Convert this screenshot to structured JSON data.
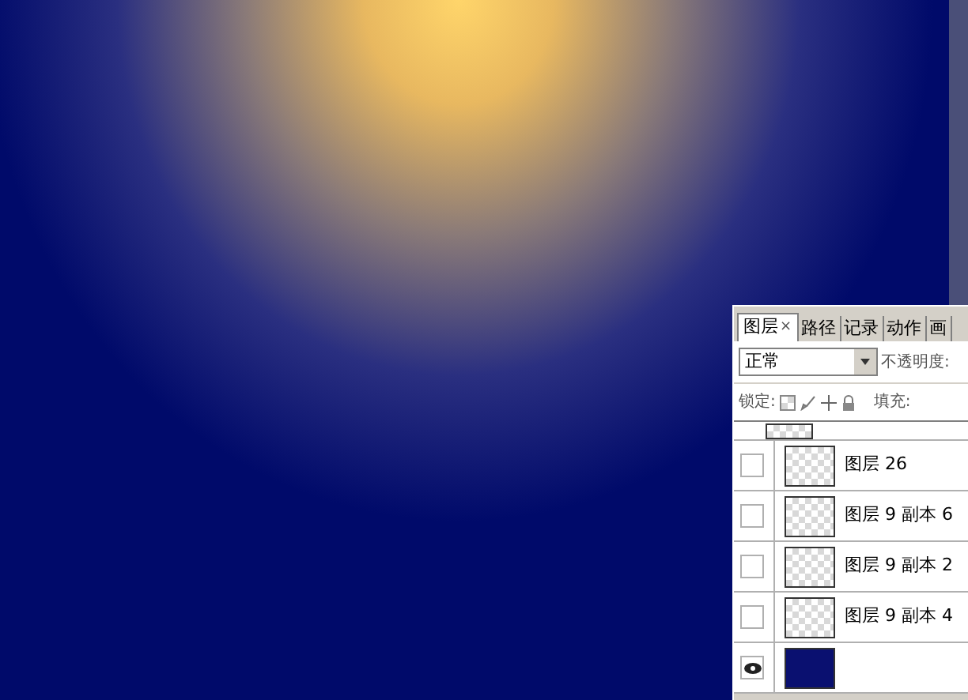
{
  "tabs": [
    {
      "label": "图层",
      "selected": true,
      "close": "×"
    },
    {
      "label": "路径",
      "selected": false
    },
    {
      "label": "记录",
      "selected": false
    },
    {
      "label": "动作",
      "selected": false
    },
    {
      "label": "画",
      "selected": false
    }
  ],
  "blend_mode": "正常",
  "opacity_label": "不透明度:",
  "lock_label": "锁定:",
  "fill_label": "填充:",
  "layers": [
    {
      "name": "图层 26",
      "visible": false,
      "kind": "transparent"
    },
    {
      "name": "图层 9 副本 6",
      "visible": false,
      "kind": "transparent"
    },
    {
      "name": "图层 9 副本 2",
      "visible": false,
      "kind": "transparent"
    },
    {
      "name": "图层 9 副本 4",
      "visible": false,
      "kind": "transparent"
    },
    {
      "visible": true,
      "kind": "fill"
    }
  ]
}
